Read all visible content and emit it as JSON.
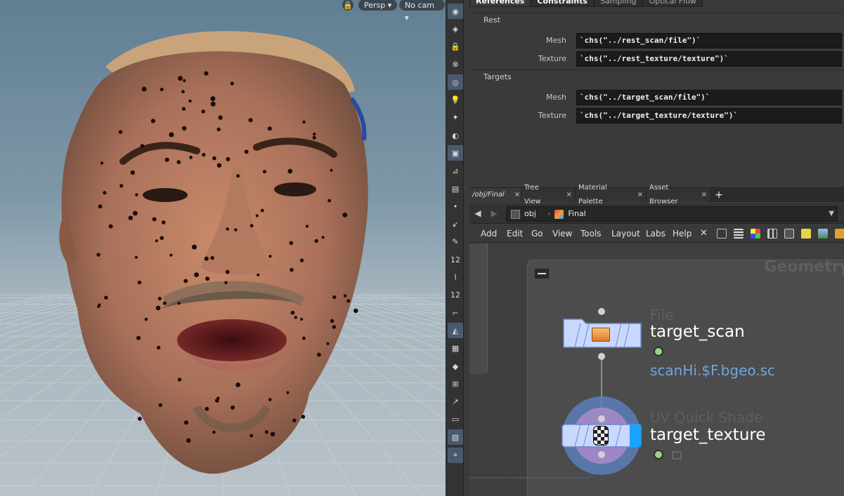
{
  "viewport": {
    "camera_mode": "Persp",
    "camera_name": "No cam"
  },
  "shelf": {
    "tools": [
      {
        "name": "view-icon",
        "glyph": "◉"
      },
      {
        "name": "select-mode-icon",
        "glyph": "◈"
      },
      {
        "name": "lock-icon",
        "glyph": "🔒"
      },
      {
        "name": "snap-icon",
        "glyph": "⊗"
      },
      {
        "name": "ghost-icon",
        "glyph": "◎"
      },
      {
        "name": "light-icon",
        "glyph": "💡"
      },
      {
        "name": "light-add-icon",
        "glyph": "✦"
      },
      {
        "name": "display-icon",
        "glyph": "◐"
      },
      {
        "name": "shading-icon",
        "glyph": "▣"
      },
      {
        "name": "wire-icon",
        "glyph": "⊿"
      },
      {
        "name": "texture-icon",
        "glyph": "▤"
      },
      {
        "name": "point-icon",
        "glyph": "•"
      },
      {
        "name": "normal-icon",
        "glyph": "↙"
      },
      {
        "name": "pen-icon",
        "glyph": "✎"
      },
      {
        "name": "number-icon",
        "glyph": "12"
      },
      {
        "name": "brush-icon",
        "glyph": "⌇"
      },
      {
        "name": "number-alt-icon",
        "glyph": "12"
      },
      {
        "name": "corner-icon",
        "glyph": "⌐"
      },
      {
        "name": "prim-icon",
        "glyph": "◭"
      },
      {
        "name": "checker-icon",
        "glyph": "▦"
      },
      {
        "name": "diamond-icon",
        "glyph": "◆"
      },
      {
        "name": "uv-icon",
        "glyph": "⊞"
      },
      {
        "name": "vector-icon",
        "glyph": "↗"
      },
      {
        "name": "grid-icon",
        "glyph": "▭"
      },
      {
        "name": "background-icon",
        "glyph": "▨"
      },
      {
        "name": "pin-icon",
        "glyph": "⌖"
      }
    ]
  },
  "params": {
    "tabs": [
      "References",
      "Constraints",
      "Sampling",
      "Optical Flow"
    ],
    "sections": [
      {
        "title": "Rest",
        "rows": [
          {
            "label": "Mesh",
            "value": "`chs(\"../rest_scan/file\")`"
          },
          {
            "label": "Texture",
            "value": "`chs(\"../rest_texture/texture\")`"
          }
        ]
      },
      {
        "title": "Targets",
        "rows": [
          {
            "label": "Mesh",
            "value": "`chs(\"../target_scan/file\")`"
          },
          {
            "label": "Texture",
            "value": "`chs(\"../target_texture/texture\")`"
          }
        ]
      }
    ]
  },
  "network": {
    "tabs": [
      {
        "label": "/obj/Final",
        "close": "×"
      },
      {
        "label": "Tree View",
        "close": "×"
      },
      {
        "label": "Material Palette",
        "close": "×"
      },
      {
        "label": "Asset Browser",
        "close": "×"
      }
    ],
    "add_tab": "+",
    "path": [
      "obj",
      "Final"
    ],
    "menu": [
      "Add",
      "Edit",
      "Go",
      "View",
      "Tools",
      "Layout",
      "Labs",
      "Help"
    ],
    "context_title": "Geometry",
    "nodes": [
      {
        "type": "File",
        "name": "target_scan",
        "param": "scanHi.$F.bgeo.sc"
      },
      {
        "type": "UV Quick Shade",
        "name": "target_texture"
      }
    ]
  },
  "colors": {
    "accent_blue": "#1aa3ff",
    "node_body": "#c9d8ff",
    "param_link": "#6ea6e0",
    "display_flag": "#9bd18b"
  }
}
